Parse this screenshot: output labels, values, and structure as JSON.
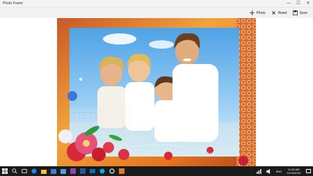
{
  "window": {
    "title": "Photo Frame",
    "minimize_glyph": "—",
    "maximize_glyph": "☐",
    "close_glyph": "✕"
  },
  "commands": {
    "photo_label": "Photo",
    "reset_label": "Reset",
    "save_label": "Save"
  },
  "taskbar": {
    "apps": [
      "start-icon",
      "search-icon",
      "task-view-icon",
      "edge-icon",
      "file-explorer-icon",
      "store-icon",
      "photos-icon",
      "visual-studio-icon",
      "word-icon",
      "mail-icon",
      "skype-icon",
      "settings-icon",
      "photo-frame-icon"
    ],
    "language": "ENG",
    "time": "11:06 AM",
    "date": "11/16/2018"
  },
  "colors": {
    "accent": "#0078d7",
    "frame_orange": "#e8761f",
    "taskbar": "#1b1b1b"
  }
}
